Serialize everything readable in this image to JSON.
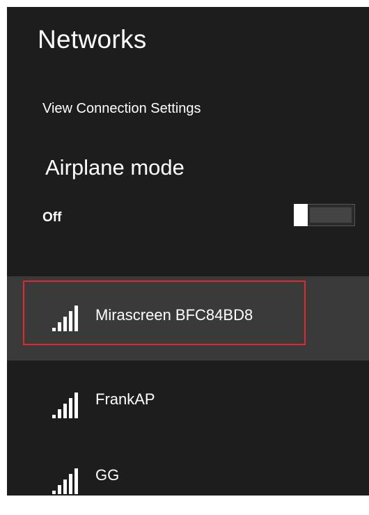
{
  "header": {
    "title": "Networks"
  },
  "connection_link": {
    "label": "View Connection Settings"
  },
  "airplane_mode": {
    "heading": "Airplane mode",
    "state": "Off",
    "enabled": false
  },
  "networks": [
    {
      "name": "Mirascreen BFC84BD8",
      "signal_icon": "wifi-signal-icon",
      "selected": true
    },
    {
      "name": "FrankAP",
      "signal_icon": "wifi-signal-icon",
      "selected": false
    },
    {
      "name": "GG",
      "signal_icon": "wifi-signal-icon",
      "selected": false
    }
  ],
  "colors": {
    "panel_background": "#1d1d1d",
    "selected_row": "#3a3a3a",
    "highlight_border": "#e0282e",
    "text": "#ffffff"
  }
}
